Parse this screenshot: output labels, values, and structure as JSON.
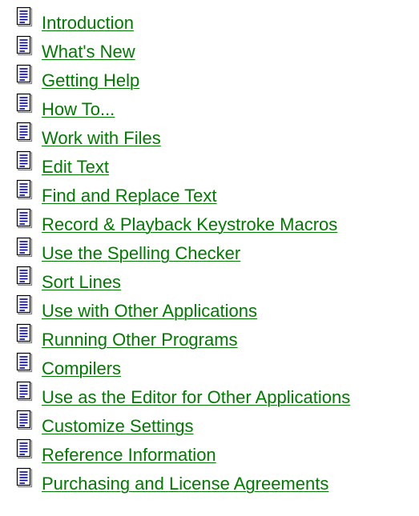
{
  "help_contents": {
    "topics": [
      {
        "label": "Introduction",
        "icon": "document-icon"
      },
      {
        "label": "What's New",
        "icon": "document-icon"
      },
      {
        "label": "Getting Help",
        "icon": "document-icon"
      },
      {
        "label": "How To...",
        "icon": "document-icon"
      },
      {
        "label": "Work with Files",
        "icon": "document-icon"
      },
      {
        "label": "Edit Text",
        "icon": "document-icon"
      },
      {
        "label": "Find and Replace Text",
        "icon": "document-icon"
      },
      {
        "label": "Record & Playback Keystroke Macros",
        "icon": "document-icon"
      },
      {
        "label": "Use the Spelling Checker",
        "icon": "document-icon"
      },
      {
        "label": "Sort Lines",
        "icon": "document-icon"
      },
      {
        "label": "Use with Other Applications",
        "icon": "document-icon"
      },
      {
        "label": "Running Other Programs",
        "icon": "document-icon"
      },
      {
        "label": "Compilers",
        "icon": "document-icon"
      },
      {
        "label": "Use as the Editor for Other Applications",
        "icon": "document-icon"
      },
      {
        "label": "Customize Settings",
        "icon": "document-icon"
      },
      {
        "label": "Reference Information",
        "icon": "document-icon"
      },
      {
        "label": "Purchasing and License Agreements",
        "icon": "document-icon"
      }
    ],
    "colors": {
      "link": "#007a00",
      "icon_fill": "#ffffff",
      "icon_outline": "#000000",
      "icon_lines": "#0000a8",
      "icon_accent": "#808080",
      "background": "#ffffff"
    }
  }
}
